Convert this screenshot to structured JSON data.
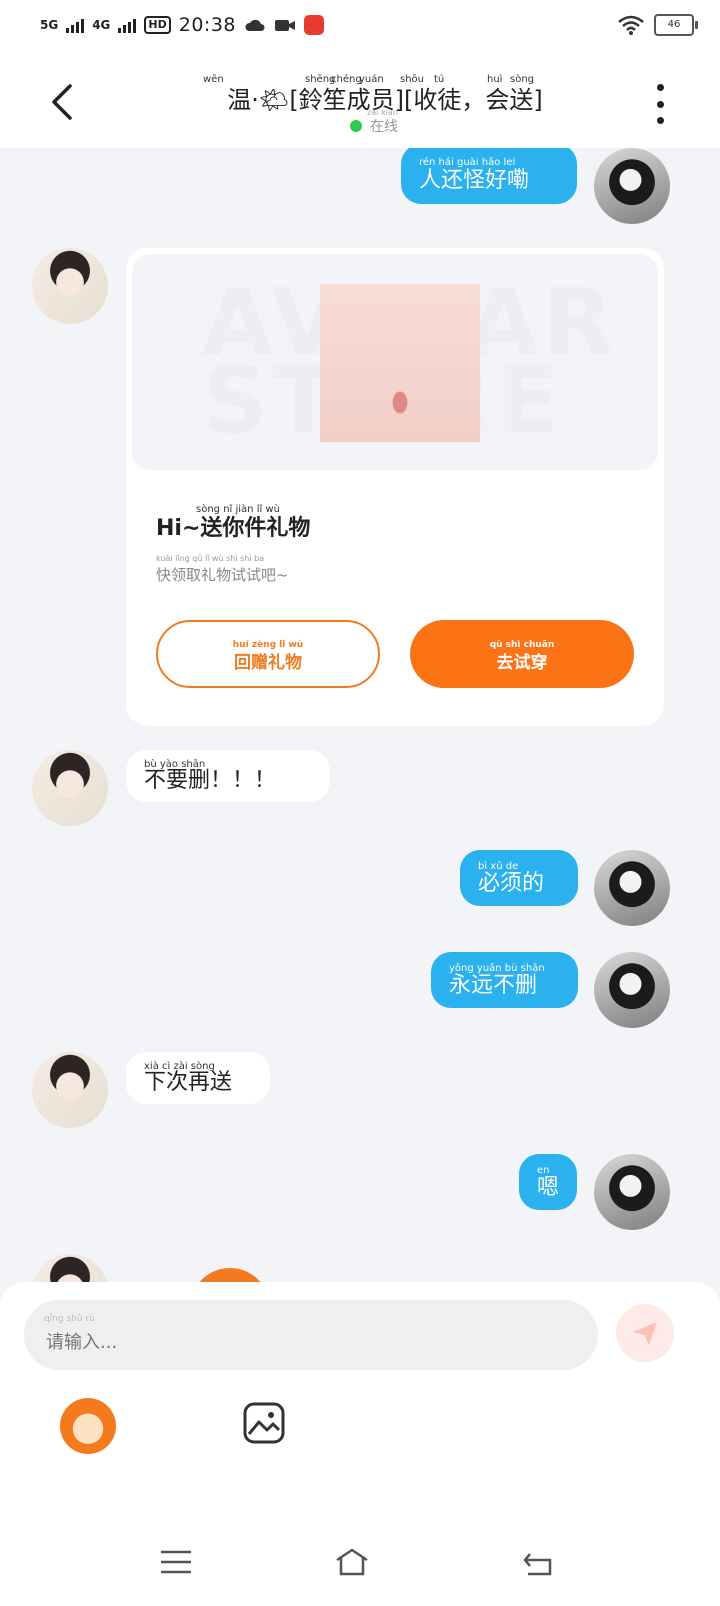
{
  "status": {
    "network1": "5G",
    "network2": "4G",
    "hd_label": "HD",
    "time": "20:38",
    "battery": "46"
  },
  "header": {
    "title": "温·🌤[鈴笙成员][收徒，会送]",
    "title_pinyin": [
      "wēn",
      "shēng",
      "chéng",
      "yuán",
      "shōu",
      "tú",
      "huì",
      "sòng"
    ],
    "online_pinyin": "zài xiàn",
    "online_text": "在线"
  },
  "messages": [
    {
      "side": "me",
      "text": "人还怪好嘞",
      "pinyin": "rén hái guài hǎo lei"
    },
    {
      "side": "other",
      "type": "gift"
    },
    {
      "side": "other",
      "text": "不要删！！！",
      "pinyin": "bù yào shān"
    },
    {
      "side": "me",
      "text": "必须的",
      "pinyin": "bì xū de"
    },
    {
      "side": "me",
      "text": "永远不删",
      "pinyin": "yǒng yuǎn bù shān"
    },
    {
      "side": "other",
      "text": "下次再送",
      "pinyin": "xià cì zài sòng"
    },
    {
      "side": "me",
      "text": "嗯",
      "pinyin": "en"
    }
  ],
  "gift_card": {
    "watermark": "AVATAR STORE",
    "title": "Hi~送你件礼物",
    "title_pinyin": "sòng nǐ jiàn lǐ wù",
    "subtitle": "快领取礼物试试吧~",
    "subtitle_pinyin": "kuài lǐng qǔ lǐ wù shì shì ba",
    "gift_back_label": "回赠礼物",
    "gift_back_pinyin": "huí zèng lǐ wù",
    "try_on_label": "去试穿",
    "try_on_pinyin": "qù shì chuān"
  },
  "composer": {
    "placeholder": "请输入...",
    "placeholder_pinyin": "qǐng shū rù"
  },
  "colors": {
    "accent_blue": "#2ab1ee",
    "accent_orange": "#fb7315",
    "online_green": "#2bcb4f"
  },
  "icons": [
    "signal-icon",
    "wifi-icon",
    "battery-icon",
    "back-icon",
    "more-icon",
    "send-icon",
    "emoji-icon",
    "image-icon",
    "menu-icon",
    "home-icon",
    "back-nav-icon"
  ]
}
